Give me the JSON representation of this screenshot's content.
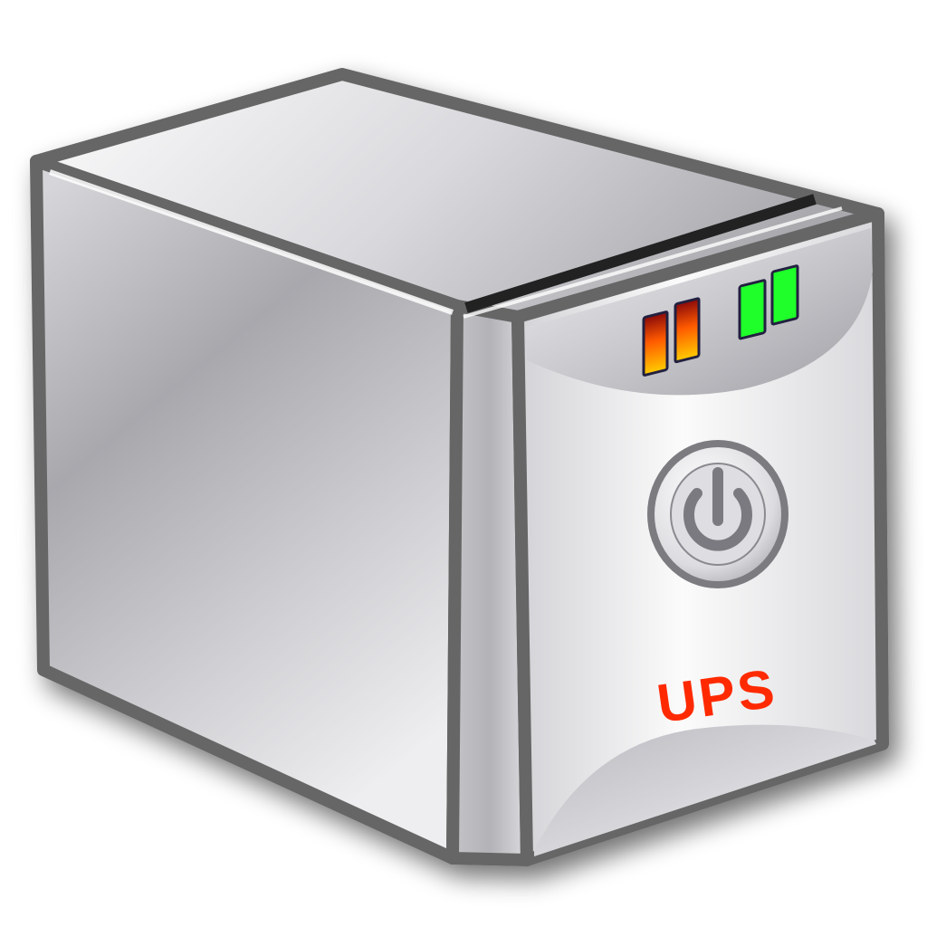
{
  "device": {
    "label": "UPS",
    "label_color": "#ff2a00",
    "power_icon": "power-icon"
  },
  "indicators": {
    "warning_leds": {
      "count": 2,
      "colors": [
        "#ff5a00",
        "#ffcc00",
        "#8a0a0a"
      ]
    },
    "status_leds": {
      "count": 2,
      "color": "#1fff2a"
    }
  },
  "colors": {
    "body_light": "#f4f4f6",
    "body_mid": "#c8c8cc",
    "body_dark": "#9a9aa0",
    "outline": "#666666"
  }
}
